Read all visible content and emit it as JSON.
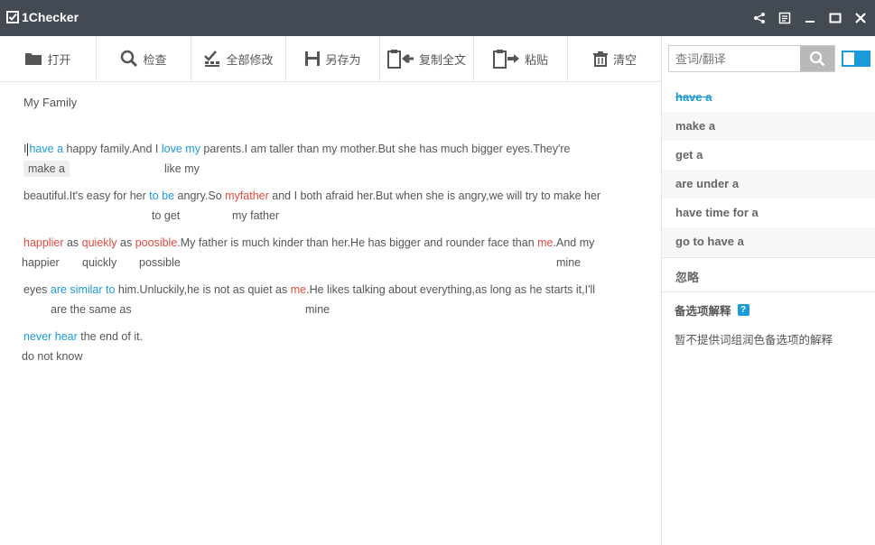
{
  "app": {
    "name": "1Checker"
  },
  "toolbar": {
    "open": "打开",
    "check": "检查",
    "fix_all": "全部修改",
    "save_as": "另存为",
    "copy_all": "复制全文",
    "paste": "粘贴",
    "clear": "清空"
  },
  "doc": {
    "title": "My Family",
    "l1": {
      "t0": "I",
      "e1": "have a",
      "t1": " happy family.And I ",
      "e2": "love my",
      "t2": " parents.I am taller than my mother.But she has much bigger eyes.They're"
    },
    "s1": {
      "a": "make a",
      "b": "like my"
    },
    "l2": {
      "t0": "beautiful.It's easy for her ",
      "e1": "to be",
      "t1": " angry.So ",
      "e2": "myfather",
      "t2": " and I both afraid her.But when she is angry,we will try to make her"
    },
    "s2": {
      "a": "to get",
      "b": "my father"
    },
    "l3": {
      "e1": "happlier",
      "t1": " as ",
      "e2": "quiekly",
      "t2": " as ",
      "e3": "poosible",
      "t3": ".My father is much kinder than her.He has bigger and rounder face than ",
      "e4": "me",
      "t4": ".And my"
    },
    "s3": {
      "a": "happier",
      "b": "quickly",
      "c": "possible",
      "d": "mine"
    },
    "l4": {
      "t0": "eyes ",
      "e1": "are similar to",
      "t1": " him.Unluckily,he is not as quiet as ",
      "e2": "me",
      "t2": ".He likes talking about everything,as long as he starts it,I'll"
    },
    "s4": {
      "a": "are the same as",
      "b": "mine"
    },
    "l5": {
      "e1": "never hear",
      "t1": " the end of it."
    },
    "s5": {
      "a": "do not know"
    }
  },
  "panel": {
    "search_placeholder": "查词/翻译",
    "suggestions": [
      "have a",
      "make a",
      "get a",
      "are under a",
      "have time for a",
      "go to have a"
    ],
    "ignore": "忽略",
    "alt_heading": "备选项解释",
    "help": "?",
    "alt_text": "暂不提供词组润色备选项的解释"
  },
  "colors": {
    "accent": "#1a9bd7",
    "error": "#e04a3f",
    "titlebar": "#434a54"
  },
  "icons": [
    "app-logo-icon",
    "share-icon",
    "notes-icon",
    "minimize-icon",
    "maximize-icon",
    "close-icon",
    "folder-icon",
    "search-icon",
    "check-list-icon",
    "save-icon",
    "copy-icon",
    "paste-icon",
    "trash-icon"
  ]
}
